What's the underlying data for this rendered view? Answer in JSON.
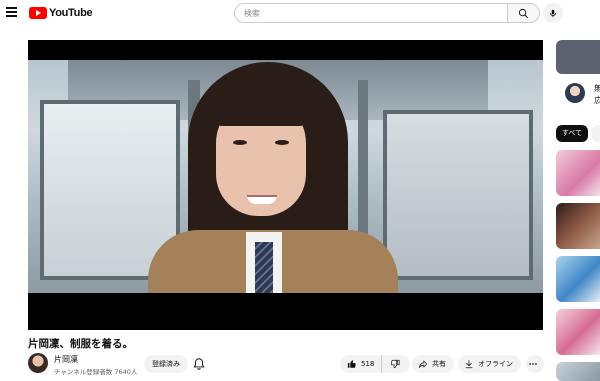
{
  "header": {
    "logo_text": "YouTube",
    "search_placeholder": "検索"
  },
  "video": {
    "title": "片岡凜、制服を着る。",
    "channel_name": "片岡凜",
    "subscriber_count": "チャンネル登録者数 7640人",
    "subscribe_button_label": "登録済み",
    "like_count": "518",
    "share_label": "共有",
    "offline_label": "オフライン"
  },
  "sidebar": {
    "ad_line1": "無",
    "ad_line2": "広",
    "filter_chip_all": "すべて"
  },
  "colors": {
    "brand_red": "#ff0000",
    "chip_active": "#0f0f0f",
    "button_bg": "#f2f2f2"
  },
  "icons": [
    "menu-icon",
    "youtube-logo-icon",
    "search-icon",
    "mic-icon",
    "bell-icon",
    "thumbs-up-icon",
    "thumbs-down-icon",
    "share-icon",
    "download-icon",
    "more-icon"
  ]
}
